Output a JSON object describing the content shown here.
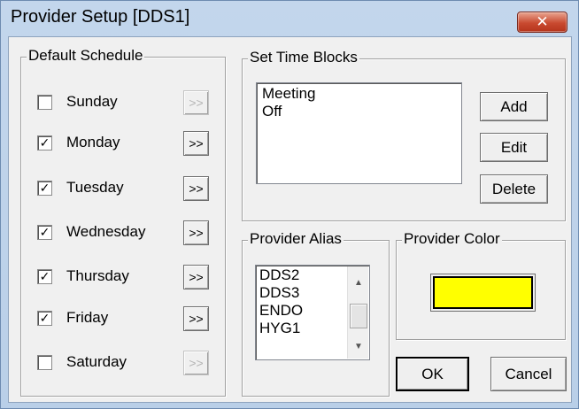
{
  "window": {
    "title": "Provider Setup [DDS1]",
    "close_symbol": "✕"
  },
  "schedule": {
    "label": "Default Schedule",
    "days": [
      {
        "name": "Sunday",
        "checked": false,
        "arrow": ">>",
        "enabled": false
      },
      {
        "name": "Monday",
        "checked": true,
        "arrow": ">>",
        "enabled": true
      },
      {
        "name": "Tuesday",
        "checked": true,
        "arrow": ">>",
        "enabled": true
      },
      {
        "name": "Wednesday",
        "checked": true,
        "arrow": ">>",
        "enabled": true
      },
      {
        "name": "Thursday",
        "checked": true,
        "arrow": ">>",
        "enabled": true
      },
      {
        "name": "Friday",
        "checked": true,
        "arrow": ">>",
        "enabled": true
      },
      {
        "name": "Saturday",
        "checked": false,
        "arrow": ">>",
        "enabled": false
      }
    ]
  },
  "time_blocks": {
    "label": "Set Time Blocks",
    "items": [
      "Meeting",
      "Off"
    ],
    "add_label": "Add",
    "edit_label": "Edit",
    "delete_label": "Delete"
  },
  "alias": {
    "label": "Provider Alias",
    "items": [
      "DDS2",
      "DDS3",
      "ENDO",
      "HYG1"
    ]
  },
  "color": {
    "label": "Provider Color",
    "value": "#ffff00"
  },
  "footer": {
    "ok_label": "OK",
    "cancel_label": "Cancel"
  }
}
